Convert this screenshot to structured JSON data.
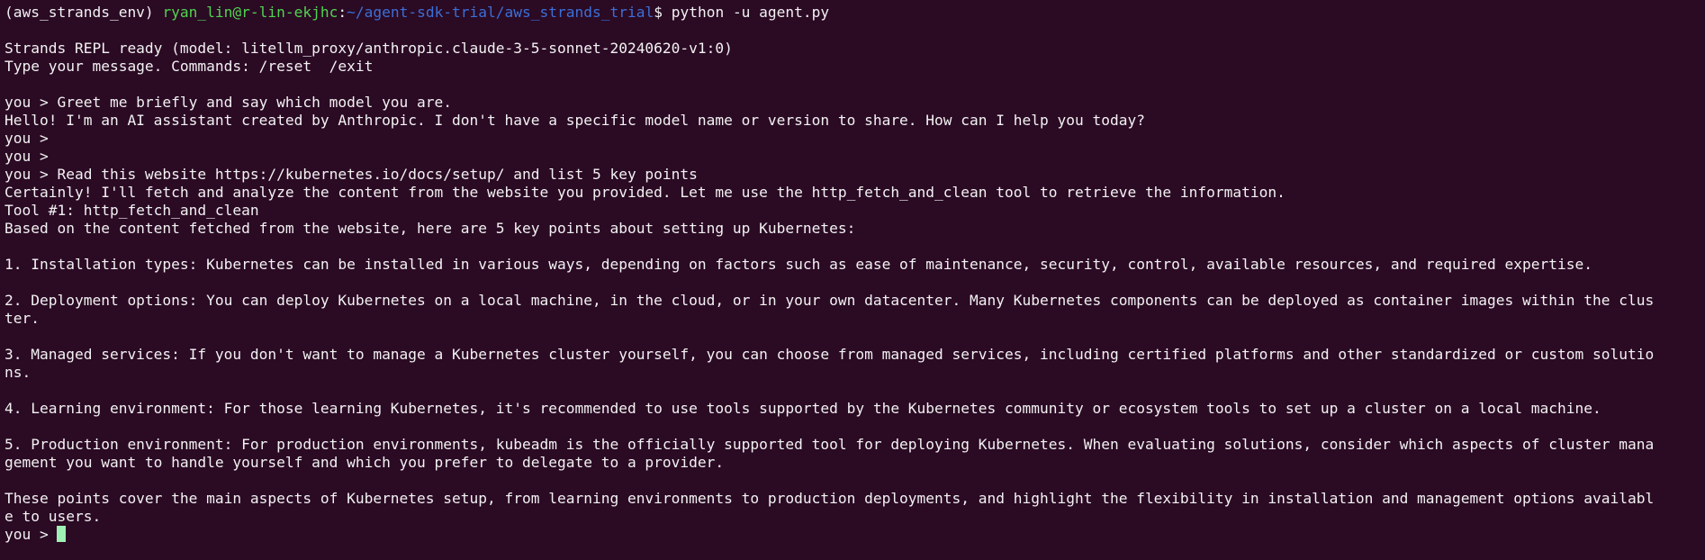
{
  "prompt": {
    "env": "(aws_strands_env)",
    "user_host": "ryan_lin@r-lin-ekjhc",
    "colon": ":",
    "path": "~/agent-sdk-trial/aws_strands_trial",
    "symbol": "$",
    "command": "python -u agent.py"
  },
  "banner": {
    "ready": "Strands REPL ready (model: litellm_proxy/anthropic.claude-3-5-sonnet-20240620-v1:0)",
    "commands": "Type your message. Commands: /reset  /exit"
  },
  "conversation": {
    "q1": "you > Greet me briefly and say which model you are.",
    "a1": "Hello! I'm an AI assistant created by Anthropic. I don't have a specific model name or version to share. How can I help you today?",
    "empty1": "you >",
    "empty2": "you >",
    "q2": "you > Read this website https://kubernetes.io/docs/setup/ and list 5 key points",
    "a2_intro": "Certainly! I'll fetch and analyze the content from the website you provided. Let me use the http_fetch_and_clean tool to retrieve the information.",
    "tool": "Tool #1: http_fetch_and_clean",
    "a2_lead": "Based on the content fetched from the website, here are 5 key points about setting up Kubernetes:",
    "p1": "1. Installation types: Kubernetes can be installed in various ways, depending on factors such as ease of maintenance, security, control, available resources, and required expertise.",
    "p2a": "2. Deployment options: You can deploy Kubernetes on a local machine, in the cloud, or in your own datacenter. Many Kubernetes components can be deployed as container images within the clus",
    "p2b": "ter.",
    "p3a": "3. Managed services: If you don't want to manage a Kubernetes cluster yourself, you can choose from managed services, including certified platforms and other standardized or custom solutio",
    "p3b": "ns.",
    "p4": "4. Learning environment: For those learning Kubernetes, it's recommended to use tools supported by the Kubernetes community or ecosystem tools to set up a cluster on a local machine.",
    "p5a": "5. Production environment: For production environments, kubeadm is the officially supported tool for deploying Kubernetes. When evaluating solutions, consider which aspects of cluster mana",
    "p5b": "gement you want to handle yourself and which you prefer to delegate to a provider.",
    "summary_a": "These points cover the main aspects of Kubernetes setup, from learning environments to production deployments, and highlight the flexibility in installation and management options availabl",
    "summary_b": "e to users.",
    "final_prompt": "you > "
  },
  "colors": {
    "background": "#2b0a24",
    "text": "#f2f2f2",
    "user_host": "#4fd44f",
    "path": "#3b6fd6",
    "cursor": "#9ff0b4"
  }
}
